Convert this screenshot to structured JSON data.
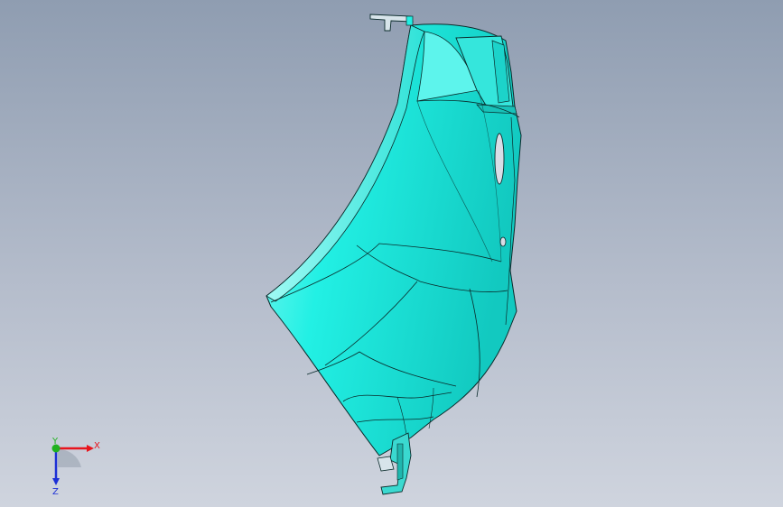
{
  "viewport": {
    "background_top": "#8f9db1",
    "background_bottom": "#cfd4de"
  },
  "model": {
    "surface_color": "#22f0e4",
    "surface_light": "#7ff7f0",
    "surface_shadow": "#12c9c0",
    "edge_color": "#0a2a2a"
  },
  "triad": {
    "x_label": "X",
    "y_label": "Y",
    "z_label": "Z",
    "x_color": "#e8141c",
    "y_color": "#1fb21f",
    "z_color": "#1c2fd6",
    "icon": "coordinate-triad-icon"
  }
}
